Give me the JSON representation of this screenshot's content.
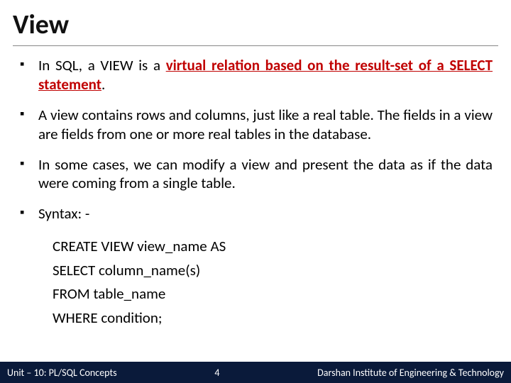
{
  "title": "View",
  "bullets": {
    "b1_pre": "In SQL, a VIEW is a ",
    "b1_bold": "virtual relation based on the result-set of a SELECT statement",
    "b1_post": ".",
    "b2": "A view contains rows and columns, just like a real table. The fields in a view are fields from one or more real tables in the database.",
    "b3": "In some cases, we can modify a view and present the data as if the data were coming from a single table.",
    "b4": "Syntax: -"
  },
  "syntax": {
    "l1": "CREATE VIEW view_name AS",
    "l2": "SELECT column_name(s)",
    "l3": "FROM table_name",
    "l4": "WHERE condition;"
  },
  "footer": {
    "left": "Unit – 10: PL/SQL Concepts",
    "page": "4",
    "right": "Darshan Institute of Engineering & Technology"
  }
}
